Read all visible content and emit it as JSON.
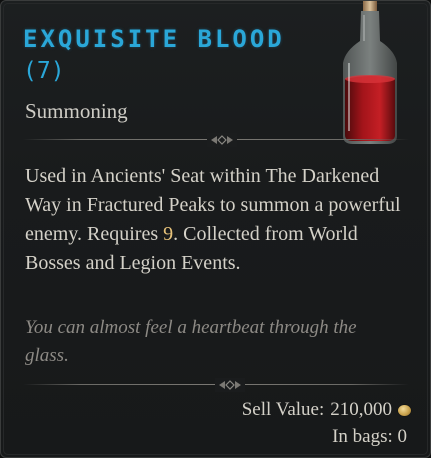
{
  "item": {
    "name": "EXQUISITE BLOOD",
    "count": "(7)",
    "type": "Summoning",
    "description": {
      "part1": "Used in Ancients' Seat within The Darkened Way in Fractured Peaks to summon a powerful enemy. Requires ",
      "highlight": "9",
      "part2": ". Collected from World Bosses and Legion Events."
    },
    "flavor": "You can almost feel a heartbeat through the glass.",
    "sell_label": "Sell Value:",
    "sell_value": "210,000",
    "bags_label": "In bags:",
    "bags_value": "0"
  },
  "icons": {
    "item_icon": "blood-bottle-icon",
    "currency_icon": "gold-coin-icon"
  },
  "colors": {
    "name": "#2aa7d8",
    "highlight": "#e6c27a",
    "flavor": "#8d8a85"
  }
}
